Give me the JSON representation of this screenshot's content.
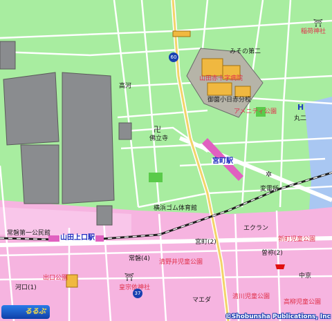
{
  "map": {
    "labels": {
      "inari_shrine": "稲荷神社",
      "misono_2": "みその第二",
      "yamada_red_cross": "山田赤十字病院",
      "misono_school": "御薗小日赤分校",
      "amenity_park": "アメニティ公園",
      "maruni": "丸二",
      "takaragawa": "高河",
      "butsuritsuji": "佛立寺",
      "miyamachi_station": "宮町駅",
      "substation": "変電所",
      "yokohama_gym": "横浜ゴム体育館",
      "tokiwa_1_hall": "常磐第一公民館",
      "yamadakamiguchi_station": "山田上口駅",
      "ecran": "エクラン",
      "miyamachi_2": "宮町(2)",
      "shinmachi_park": "新町児童公園",
      "tokiwa_4": "常磐(4)",
      "kiyonoi_park": "清野井児童公園",
      "sone_2": "曽祢(2)",
      "deguchi_park": "出口公園",
      "kotai_shrine": "皇宗依神社",
      "naka_kyo": "中京",
      "maeda": "マエダ",
      "kiyokawa_park": "清川児童公園",
      "kawaguchi": "河口(1)",
      "takayanagi_park": "高柳児童公園"
    },
    "routes": {
      "north": "60",
      "south": "37"
    },
    "logo_text": "るるぶ",
    "credit": "©Shobunsha Publications, Inc"
  }
}
